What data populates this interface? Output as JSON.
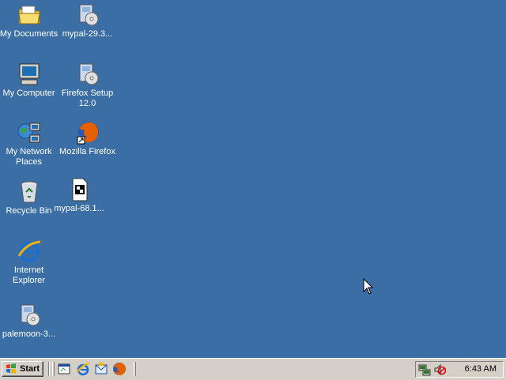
{
  "desktop": {
    "icons": [
      {
        "label": "My Documents",
        "icon": "folder-icon"
      },
      {
        "label": "mypal-29.3...",
        "icon": "installer-icon"
      },
      {
        "label": "My Computer",
        "icon": "computer-icon"
      },
      {
        "label": "Firefox Setup 12.0",
        "icon": "installer-icon"
      },
      {
        "label": "My Network Places",
        "icon": "network-icon"
      },
      {
        "label": "Mozilla Firefox",
        "icon": "firefox-icon"
      },
      {
        "label": "Recycle Bin",
        "icon": "recycle-bin-icon"
      },
      {
        "label": "mypal-68.1...",
        "icon": "media-file-icon"
      },
      {
        "label": "Internet Explorer",
        "icon": "ie-icon"
      },
      {
        "label": "palemoon-3...",
        "icon": "installer-icon"
      }
    ],
    "background": "#3a6ea5"
  },
  "taskbar": {
    "start_label": "Start",
    "quick_launch": [
      "show-desktop-icon",
      "ie-icon",
      "outlook-icon",
      "firefox-icon"
    ],
    "tray": {
      "icons": [
        "network-tray-icon",
        "volume-muted-icon"
      ],
      "clock": "6:43 AM"
    }
  }
}
